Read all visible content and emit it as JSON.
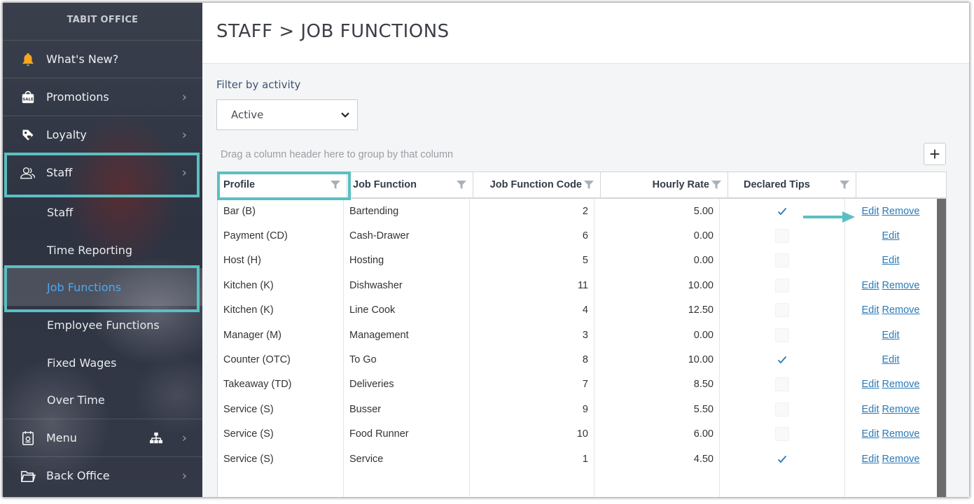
{
  "sidebar": {
    "brand": "TABIT OFFICE",
    "items": [
      {
        "label": "What's New?",
        "icon": "bell-icon",
        "color": "#f5a623"
      },
      {
        "label": "Promotions",
        "icon": "sale-bag-icon"
      },
      {
        "label": "Loyalty",
        "icon": "tag-icon"
      },
      {
        "label": "Staff",
        "icon": "users-icon"
      },
      {
        "label": "Menu",
        "icon": "menu-book-icon",
        "extra_icon": "sitemap-icon"
      },
      {
        "label": "Back Office",
        "icon": "folder-icon"
      }
    ],
    "staff_sub_items": [
      {
        "label": "Staff"
      },
      {
        "label": "Time Reporting"
      },
      {
        "label": "Job Functions",
        "active": true
      },
      {
        "label": "Employee Functions"
      },
      {
        "label": "Fixed Wages"
      },
      {
        "label": "Over Time"
      }
    ],
    "active_color": "#4ba8f0",
    "highlight_color": "#5bbfc1"
  },
  "header": {
    "title": "STAFF > JOB FUNCTIONS"
  },
  "filter": {
    "label": "Filter by activity",
    "selected": "Active"
  },
  "grid": {
    "group_hint": "Drag a column header here to group by that column",
    "add_label": "+",
    "columns": [
      "Profile",
      "Job Function",
      "Job Function Code",
      "Hourly Rate",
      "Declared Tips",
      ""
    ],
    "edit_label": "Edit",
    "remove_label": "Remove",
    "rows": [
      {
        "profile": "Bar (B)",
        "job_function": "Bartending",
        "code": "2",
        "rate": "5.00",
        "tips": true,
        "edit": true,
        "remove": true
      },
      {
        "profile": "Payment (CD)",
        "job_function": "Cash-Drawer",
        "code": "6",
        "rate": "0.00",
        "tips": false,
        "edit": true,
        "remove": false
      },
      {
        "profile": "Host (H)",
        "job_function": "Hosting",
        "code": "5",
        "rate": "0.00",
        "tips": false,
        "edit": true,
        "remove": false
      },
      {
        "profile": "Kitchen (K)",
        "job_function": "Dishwasher",
        "code": "11",
        "rate": "10.00",
        "tips": false,
        "edit": true,
        "remove": true
      },
      {
        "profile": "Kitchen (K)",
        "job_function": "Line Cook",
        "code": "4",
        "rate": "12.50",
        "tips": false,
        "edit": true,
        "remove": true
      },
      {
        "profile": "Manager (M)",
        "job_function": "Management",
        "code": "3",
        "rate": "0.00",
        "tips": false,
        "edit": true,
        "remove": false
      },
      {
        "profile": "Counter (OTC)",
        "job_function": "To Go",
        "code": "8",
        "rate": "10.00",
        "tips": true,
        "edit": true,
        "remove": false
      },
      {
        "profile": "Takeaway (TD)",
        "job_function": "Deliveries",
        "code": "7",
        "rate": "8.50",
        "tips": false,
        "edit": true,
        "remove": true
      },
      {
        "profile": "Service (S)",
        "job_function": "Busser",
        "code": "9",
        "rate": "5.50",
        "tips": false,
        "edit": true,
        "remove": true
      },
      {
        "profile": "Service (S)",
        "job_function": "Food Runner",
        "code": "10",
        "rate": "6.00",
        "tips": false,
        "edit": true,
        "remove": true
      },
      {
        "profile": "Service (S)",
        "job_function": "Service",
        "code": "1",
        "rate": "4.50",
        "tips": true,
        "edit": true,
        "remove": true
      }
    ],
    "link_color": "#2a7ab8",
    "check_color": "#2a7ab8"
  }
}
